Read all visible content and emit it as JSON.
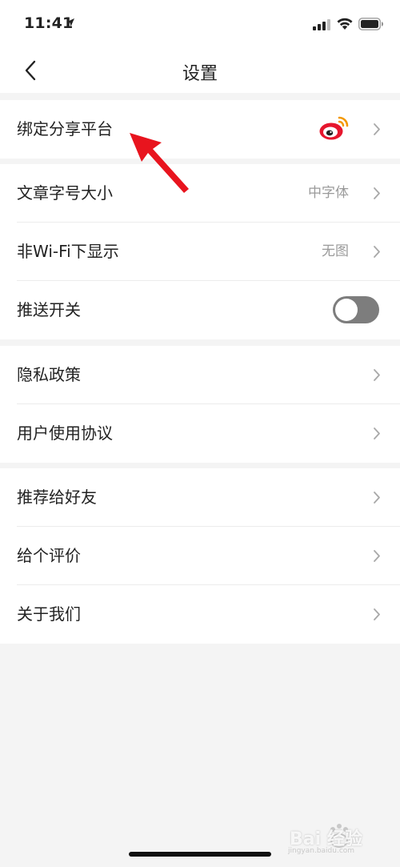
{
  "status_bar": {
    "time": "11:41",
    "icons": [
      "location-arrow-icon",
      "cellular-signal-icon",
      "wifi-icon",
      "battery-icon"
    ]
  },
  "nav": {
    "title": "设置",
    "back_icon": "chevron-left-icon"
  },
  "groups": [
    {
      "rows": [
        {
          "label": "绑定分享平台",
          "icon": "weibo-icon",
          "accessory": "chevron"
        }
      ]
    },
    {
      "rows": [
        {
          "label": "文章字号大小",
          "value": "中字体",
          "accessory": "chevron"
        },
        {
          "label": "非Wi-Fi下显示",
          "value": "无图",
          "accessory": "chevron"
        },
        {
          "label": "推送开关",
          "accessory": "toggle",
          "toggle_on": false
        }
      ]
    },
    {
      "rows": [
        {
          "label": "隐私政策",
          "accessory": "chevron"
        },
        {
          "label": "用户使用协议",
          "accessory": "chevron"
        }
      ]
    },
    {
      "rows": [
        {
          "label": "推荐给好友",
          "accessory": "chevron"
        },
        {
          "label": "给个评价",
          "accessory": "chevron"
        },
        {
          "label": "关于我们",
          "accessory": "chevron"
        }
      ]
    }
  ],
  "watermark": {
    "text": "Bai 经验",
    "sub": "jingyan.baidu.com"
  },
  "colors": {
    "background": "#f4f4f4",
    "card": "#ffffff",
    "secondary_text": "#9a9a9a",
    "toggle_off": "#7d7d7d",
    "weibo_red": "#e6162d",
    "annotation_arrow": "#e8141e"
  }
}
